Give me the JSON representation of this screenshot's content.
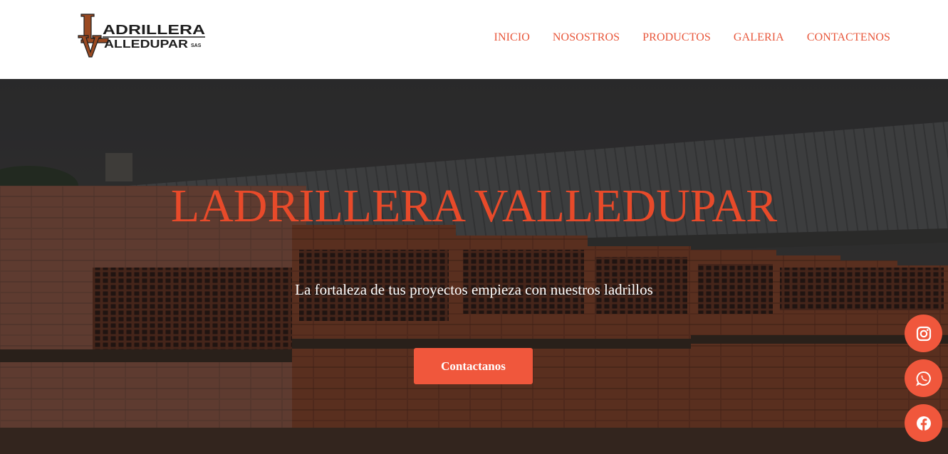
{
  "brand": {
    "logo_line1": "ADRILLERA",
    "logo_line2": "ALLEDUPAR",
    "logo_suffix": "SAS",
    "logo_letter_l": "L",
    "logo_letter_v": "V",
    "logo_colors": {
      "brown": "#9a4a22",
      "dark": "#1e1e1e"
    }
  },
  "nav": {
    "items": [
      {
        "label": "INICIO"
      },
      {
        "label": "NOSOSTROS"
      },
      {
        "label": "PRODUCTOS"
      },
      {
        "label": "GALERIA"
      },
      {
        "label": "CONTACTENOS"
      }
    ]
  },
  "hero": {
    "title": "LADRILLERA VALLEDUPAR",
    "subtitle": "La fortaleza de tus proyectos empieza con nuestros ladrillos",
    "cta_label": "Contactanos",
    "background_icon": "brick-stacks-photo"
  },
  "social": [
    {
      "name": "instagram",
      "icon": "instagram-icon"
    },
    {
      "name": "whatsapp",
      "icon": "whatsapp-icon"
    },
    {
      "name": "facebook",
      "icon": "facebook-icon"
    }
  ],
  "colors": {
    "accent": "#f0573c",
    "title_red": "#e84a2a",
    "nav_text": "#e8563a",
    "text_white": "#ffffff"
  }
}
